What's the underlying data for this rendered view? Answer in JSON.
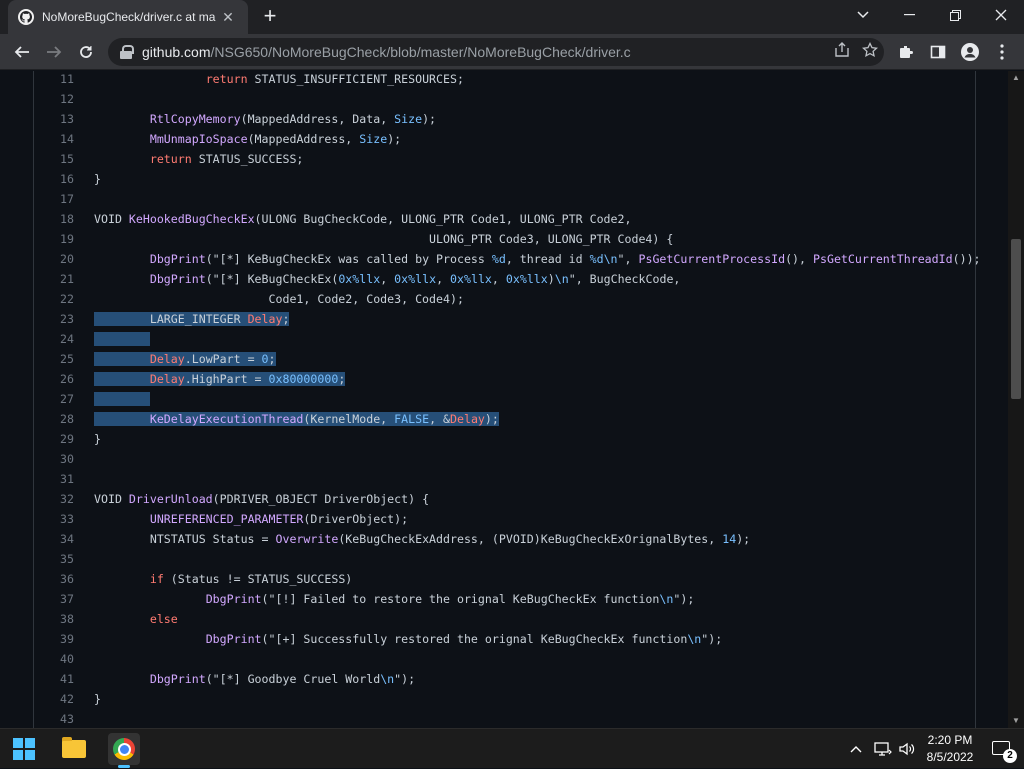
{
  "browser": {
    "tab_title": "NoMoreBugCheck/driver.c at ma",
    "tab_icon": "github-icon",
    "url_host": "github.com",
    "url_path": "/NSG650/NoMoreBugCheck/blob/master/NoMoreBugCheck/driver.c"
  },
  "code_lines": [
    {
      "n": "11",
      "hl": false,
      "tokens": [
        [
          "p",
          "                "
        ],
        [
          "kw",
          "return"
        ],
        [
          "p",
          " STATUS_INSUFFICIENT_RESOURCES;"
        ]
      ]
    },
    {
      "n": "12",
      "hl": false,
      "tokens": []
    },
    {
      "n": "13",
      "hl": false,
      "tokens": [
        [
          "p",
          "        "
        ],
        [
          "fn",
          "RtlCopyMemory"
        ],
        [
          "p",
          "(MappedAddress, Data, "
        ],
        [
          "cst",
          "Size"
        ],
        [
          "p",
          ");"
        ]
      ]
    },
    {
      "n": "14",
      "hl": false,
      "tokens": [
        [
          "p",
          "        "
        ],
        [
          "fn",
          "MmUnmapIoSpace"
        ],
        [
          "p",
          "(MappedAddress, "
        ],
        [
          "cst",
          "Size"
        ],
        [
          "p",
          ");"
        ]
      ]
    },
    {
      "n": "15",
      "hl": false,
      "tokens": [
        [
          "p",
          "        "
        ],
        [
          "kw",
          "return"
        ],
        [
          "p",
          " STATUS_SUCCESS;"
        ]
      ]
    },
    {
      "n": "16",
      "hl": false,
      "tokens": [
        [
          "p",
          "}"
        ]
      ]
    },
    {
      "n": "17",
      "hl": false,
      "tokens": []
    },
    {
      "n": "18",
      "hl": false,
      "tokens": [
        [
          "p",
          "VOID "
        ],
        [
          "fn",
          "KeHookedBugCheckEx"
        ],
        [
          "p",
          "(ULONG BugCheckCode, ULONG_PTR Code1, ULONG_PTR Code2,"
        ]
      ]
    },
    {
      "n": "19",
      "hl": false,
      "tokens": [
        [
          "p",
          "                                                ULONG_PTR Code3, ULONG_PTR Code4) {"
        ]
      ]
    },
    {
      "n": "20",
      "hl": false,
      "tokens": [
        [
          "p",
          "        "
        ],
        [
          "fn",
          "DbgPrint"
        ],
        [
          "p",
          "(\"[*] KeBugCheckEx was called by Process "
        ],
        [
          "cst",
          "%d"
        ],
        [
          "p",
          ", thread id "
        ],
        [
          "cst",
          "%d\\n"
        ],
        [
          "p",
          "\", "
        ],
        [
          "fn",
          "PsGetCurrentProcessId"
        ],
        [
          "p",
          "(), "
        ],
        [
          "fn",
          "PsGetCurrentThreadId"
        ],
        [
          "p",
          "());"
        ]
      ]
    },
    {
      "n": "21",
      "hl": false,
      "tokens": [
        [
          "p",
          "        "
        ],
        [
          "fn",
          "DbgPrint"
        ],
        [
          "p",
          "(\"[*] KeBugCheckEx("
        ],
        [
          "cst",
          "0x%llx"
        ],
        [
          "p",
          ", "
        ],
        [
          "cst",
          "0x%llx"
        ],
        [
          "p",
          ", "
        ],
        [
          "cst",
          "0x%llx"
        ],
        [
          "p",
          ", "
        ],
        [
          "cst",
          "0x%llx"
        ],
        [
          "p",
          ")"
        ],
        [
          "cst",
          "\\n"
        ],
        [
          "p",
          "\", BugCheckCode,"
        ]
      ]
    },
    {
      "n": "22",
      "hl": false,
      "tokens": [
        [
          "p",
          "                         Code1, Code2, Code3, Code4);"
        ]
      ]
    },
    {
      "n": "23",
      "hl": true,
      "tokens": [
        [
          "p",
          "        LARGE_INTEGER "
        ],
        [
          "var",
          "Delay"
        ],
        [
          "p",
          ";"
        ]
      ]
    },
    {
      "n": "24",
      "hl": true,
      "tokens": [
        [
          "p",
          "        "
        ]
      ]
    },
    {
      "n": "25",
      "hl": true,
      "tokens": [
        [
          "p",
          "        "
        ],
        [
          "var",
          "Delay"
        ],
        [
          "p",
          ".LowPart = "
        ],
        [
          "cst",
          "0"
        ],
        [
          "p",
          ";"
        ]
      ]
    },
    {
      "n": "26",
      "hl": true,
      "tokens": [
        [
          "p",
          "        "
        ],
        [
          "var",
          "Delay"
        ],
        [
          "p",
          ".HighPart = "
        ],
        [
          "cst",
          "0x80000000"
        ],
        [
          "p",
          ";"
        ]
      ]
    },
    {
      "n": "27",
      "hl": true,
      "tokens": [
        [
          "p",
          "        "
        ]
      ]
    },
    {
      "n": "28",
      "hl": true,
      "tokens": [
        [
          "p",
          "        "
        ],
        [
          "fn",
          "KeDelayExecutionThread"
        ],
        [
          "p",
          "(KernelMode, "
        ],
        [
          "cst",
          "FALSE"
        ],
        [
          "p",
          ", &"
        ],
        [
          "var",
          "Delay"
        ],
        [
          "p",
          ");"
        ]
      ]
    },
    {
      "n": "29",
      "hl": false,
      "tokens": [
        [
          "p",
          "}"
        ]
      ]
    },
    {
      "n": "30",
      "hl": false,
      "tokens": []
    },
    {
      "n": "31",
      "hl": false,
      "tokens": []
    },
    {
      "n": "32",
      "hl": false,
      "tokens": [
        [
          "p",
          "VOID "
        ],
        [
          "fn",
          "DriverUnload"
        ],
        [
          "p",
          "(PDRIVER_OBJECT DriverObject) {"
        ]
      ]
    },
    {
      "n": "33",
      "hl": false,
      "tokens": [
        [
          "p",
          "        "
        ],
        [
          "fn",
          "UNREFERENCED_PARAMETER"
        ],
        [
          "p",
          "(DriverObject);"
        ]
      ]
    },
    {
      "n": "34",
      "hl": false,
      "tokens": [
        [
          "p",
          "        NTSTATUS Status = "
        ],
        [
          "fn",
          "Overwrite"
        ],
        [
          "p",
          "(KeBugCheckExAddress, (PVOID)KeBugCheckExOrignalBytes, "
        ],
        [
          "cst",
          "14"
        ],
        [
          "p",
          ");"
        ]
      ]
    },
    {
      "n": "35",
      "hl": false,
      "tokens": []
    },
    {
      "n": "36",
      "hl": false,
      "tokens": [
        [
          "p",
          "        "
        ],
        [
          "kw",
          "if"
        ],
        [
          "p",
          " (Status != STATUS_SUCCESS)"
        ]
      ]
    },
    {
      "n": "37",
      "hl": false,
      "tokens": [
        [
          "p",
          "                "
        ],
        [
          "fn",
          "DbgPrint"
        ],
        [
          "p",
          "(\"[!] Failed to restore the orignal KeBugCheckEx function"
        ],
        [
          "cst",
          "\\n"
        ],
        [
          "p",
          "\");"
        ]
      ]
    },
    {
      "n": "38",
      "hl": false,
      "tokens": [
        [
          "p",
          "        "
        ],
        [
          "kw",
          "else"
        ]
      ]
    },
    {
      "n": "39",
      "hl": false,
      "tokens": [
        [
          "p",
          "                "
        ],
        [
          "fn",
          "DbgPrint"
        ],
        [
          "p",
          "(\"[+] Successfully restored the orignal KeBugCheckEx function"
        ],
        [
          "cst",
          "\\n"
        ],
        [
          "p",
          "\");"
        ]
      ]
    },
    {
      "n": "40",
      "hl": false,
      "tokens": []
    },
    {
      "n": "41",
      "hl": false,
      "tokens": [
        [
          "p",
          "        "
        ],
        [
          "fn",
          "DbgPrint"
        ],
        [
          "p",
          "(\"[*] Goodbye Cruel World"
        ],
        [
          "cst",
          "\\n"
        ],
        [
          "p",
          "\");"
        ]
      ]
    },
    {
      "n": "42",
      "hl": false,
      "tokens": [
        [
          "p",
          "}"
        ]
      ]
    },
    {
      "n": "43",
      "hl": false,
      "tokens": []
    }
  ],
  "taskbar": {
    "time": "2:20 PM",
    "date": "8/5/2022",
    "notification_count": "2"
  },
  "colors": {
    "page_bg": "#0d1117",
    "selection": "#264f78",
    "keyword": "#ff7b72",
    "function": "#d2a8ff",
    "constant": "#79c0ff"
  }
}
